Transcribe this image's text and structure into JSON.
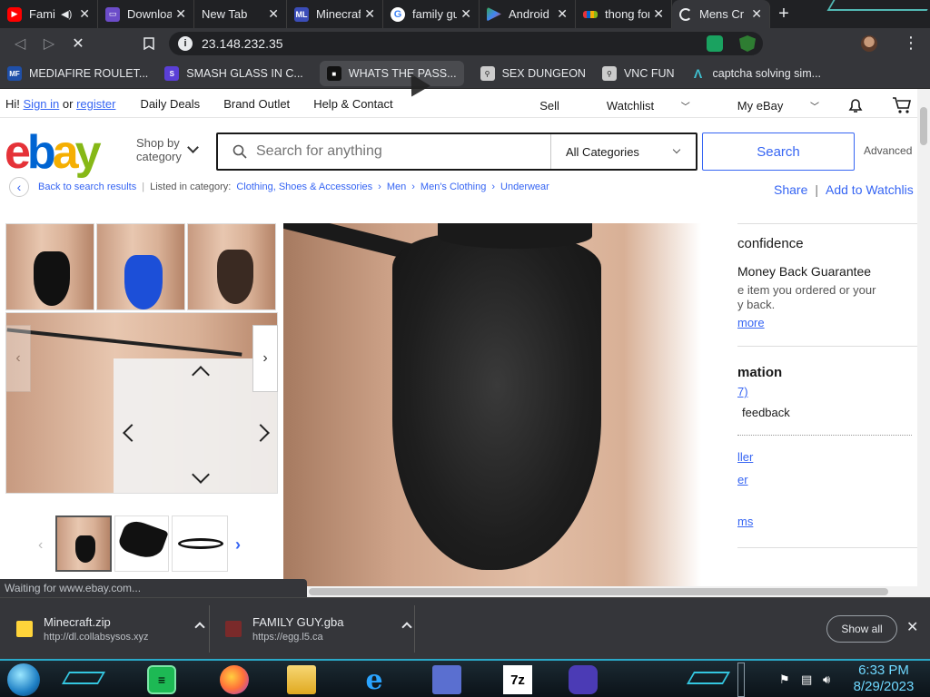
{
  "tabs": [
    {
      "title": "Fami",
      "favicon": "youtube-icon",
      "color": "#ff0000",
      "audio": true
    },
    {
      "title": "Download",
      "favicon": "monitor-icon",
      "color": "#6c4cc9"
    },
    {
      "title": "New Tab",
      "favicon": "",
      "color": ""
    },
    {
      "title": "Minecraft",
      "favicon": "ML",
      "color": "#3b4db8"
    },
    {
      "title": "family guy",
      "favicon": "google-icon",
      "color": "#4285f4"
    },
    {
      "title": "Android",
      "favicon": "play-icon",
      "color": "#34a853"
    },
    {
      "title": "thong for",
      "favicon": "ebay-icon",
      "color": "#e53238"
    },
    {
      "title": "Mens Cr",
      "favicon": "loading-icon",
      "color": "#e8eaed",
      "active": true
    }
  ],
  "address": {
    "url": "23.148.232.35"
  },
  "bookmarks": [
    {
      "label": "MEDIAFIRE ROULET...",
      "icon": "MF",
      "color": "#1f4fa8"
    },
    {
      "label": "SMASH GLASS IN C...",
      "icon": "S",
      "color": "#5a3fd6"
    },
    {
      "label": "WHATS THE PASS...",
      "icon": "W",
      "color": "#111111"
    },
    {
      "label": "SEX DUNGEON",
      "icon": "wizard",
      "color": "#cccccc"
    },
    {
      "label": "VNC FUN",
      "icon": "wizard",
      "color": "#cccccc"
    },
    {
      "label": "captcha solving sim...",
      "icon": "A",
      "color": "#3fc0d0"
    }
  ],
  "ebay": {
    "greeting_prefix": "Hi!",
    "sign_in": "Sign in",
    "or": "or",
    "register": "register",
    "nav_left": [
      "Daily Deals",
      "Brand Outlet",
      "Help & Contact"
    ],
    "sell": "Sell",
    "watchlist": "Watchlist",
    "my_ebay": "My eBay",
    "shop_by_category": [
      "Shop by",
      "category"
    ],
    "search_placeholder": "Search for anything",
    "all_categories": "All Categories",
    "search_button": "Search",
    "advanced": "Advanced",
    "back_to_results": "Back to search results",
    "listed_in": "Listed in category:",
    "breadcrumbs": [
      "Clothing, Shoes & Accessories",
      "Men",
      "Men's Clothing",
      "Underwear"
    ],
    "share": "Share",
    "add_to_watchlist": "Add to Watchlis",
    "right_panel": {
      "confidence": "confidence",
      "mbg": "Money Back Guarantee",
      "mbg_text1": "e item you ordered or your",
      "mbg_text2": "y back.",
      "more": "more",
      "info_head": "mation",
      "count": "7)",
      "feedback": "feedback",
      "link1": "ller",
      "link2": "er",
      "link3": "ms"
    }
  },
  "status_text": "Waiting for www.ebay.com...",
  "downloads": [
    {
      "name": "Minecraft.zip",
      "url": "http://dl.collabsysos.xyz"
    },
    {
      "name": "FAMILY GUY.gba",
      "url": "https://egg.l5.ca"
    }
  ],
  "show_all": "Show all",
  "clock": {
    "time": "6:33 PM",
    "date": "8/29/2023"
  }
}
